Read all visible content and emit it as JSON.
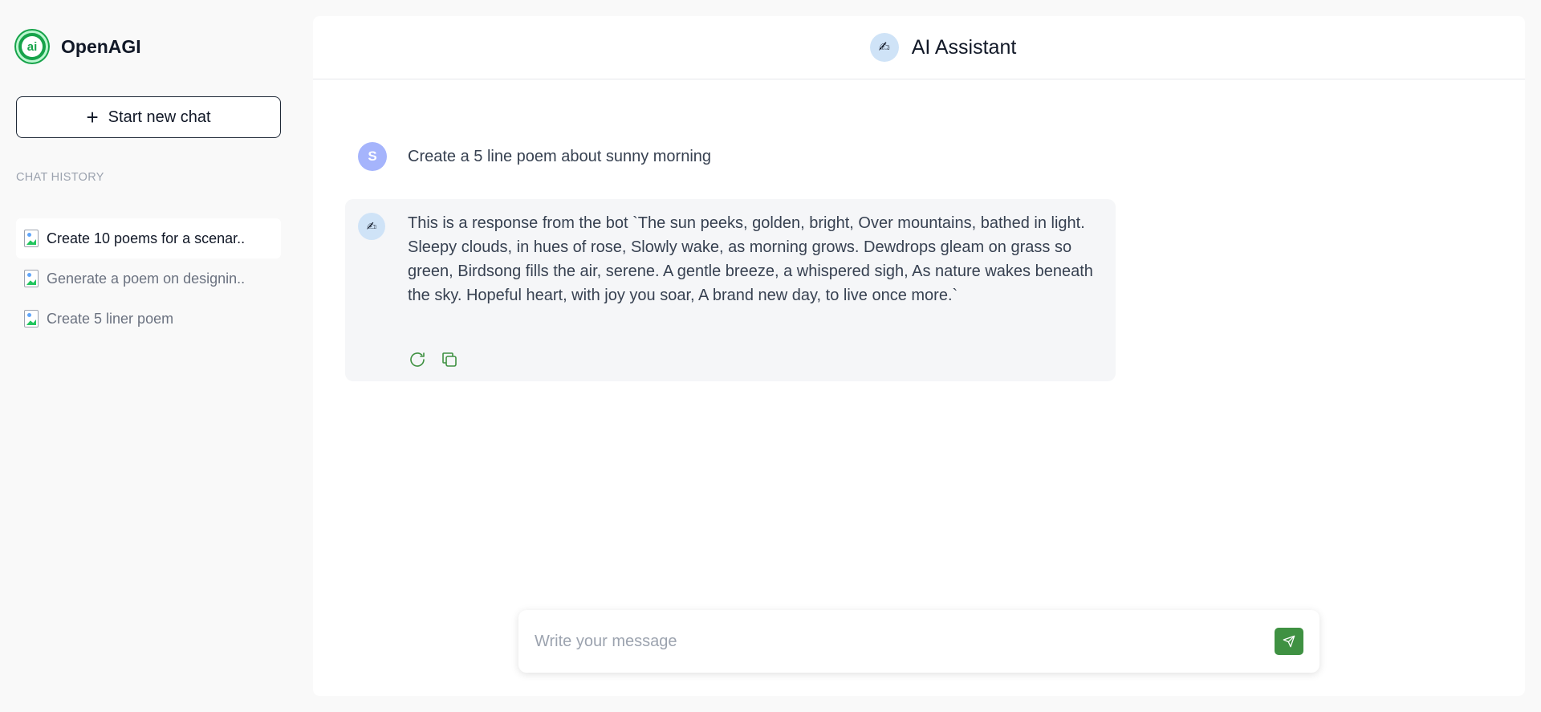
{
  "sidebar": {
    "brand": {
      "logo_text": "ai",
      "name": "OpenAGI"
    },
    "new_chat_label": "Start new chat",
    "history_title": "CHAT HISTORY",
    "history": [
      {
        "label": "Create 10 poems for a scenar..",
        "active": true
      },
      {
        "label": "Generate a poem on designin..",
        "active": false
      },
      {
        "label": "Create 5 liner poem",
        "active": false
      }
    ]
  },
  "header": {
    "avatar_glyph": "✍",
    "title": "AI Assistant"
  },
  "conversation": {
    "user": {
      "initial": "S",
      "message": "Create a 5 line poem about sunny morning"
    },
    "bot": {
      "avatar_glyph": "✍",
      "message": "This is a response from the bot `The sun peeks, golden, bright, Over mountains, bathed in light. Sleepy clouds, in hues of rose, Slowly wake, as morning grows. Dewdrops gleam on grass so green, Birdsong fills the air, serene. A gentle breeze, a whispered sigh, As nature wakes beneath the sky. Hopeful heart, with joy you soar, A brand new day, to live once more.`",
      "actions": [
        "regenerate-icon",
        "copy-icon"
      ]
    }
  },
  "composer": {
    "placeholder": "Write your message",
    "value": ""
  },
  "colors": {
    "accent": "#3f9142",
    "brand": "#16a34a",
    "user_avatar": "#a5b4fc",
    "bot_avatar": "#cfe3f7"
  }
}
